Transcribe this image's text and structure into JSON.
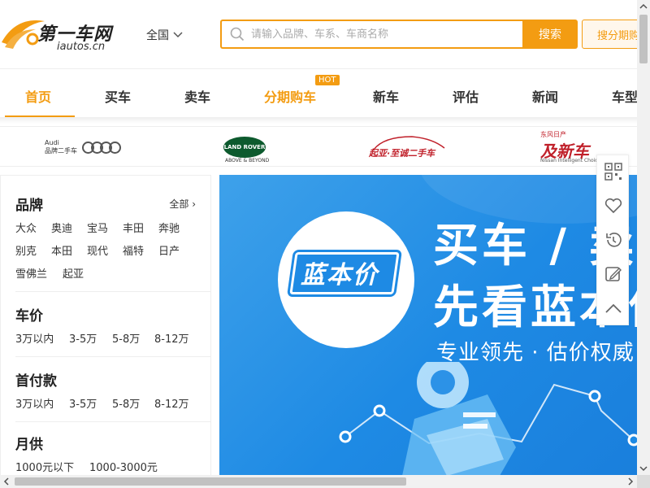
{
  "header": {
    "logo_title": "第一车网",
    "logo_sub": "iautos.cn",
    "city": "全国",
    "search_placeholder": "请输入品牌、车系、车商名称",
    "search_button": "搜索",
    "installment_button": "搜分期购"
  },
  "nav": {
    "items": [
      "首页",
      "买车",
      "卖车",
      "分期购车",
      "新车",
      "评估",
      "新闻",
      "车型"
    ],
    "active_index": 0,
    "hot_badge": "HOT"
  },
  "brand_strip": {
    "audi_line1": "Audi",
    "audi_line2": "品牌二手车",
    "land_rover": "LAND ROVER",
    "land_rover_sub": "ABOVE & BEYOND",
    "kia": "起亚·至诚二手车",
    "nissan_top": "东风日产",
    "nissan": "及新车",
    "nissan_sub": "Nissan Intelligent Choice"
  },
  "filter": {
    "brand": {
      "title": "品牌",
      "all_label": "全部",
      "options": [
        "大众",
        "奥迪",
        "宝马",
        "丰田",
        "奔驰",
        "别克",
        "本田",
        "现代",
        "福特",
        "日产",
        "雪佛兰",
        "起亚"
      ]
    },
    "price": {
      "title": "车价",
      "options": [
        "3万以内",
        "3-5万",
        "5-8万",
        "8-12万"
      ]
    },
    "down_payment": {
      "title": "首付款",
      "options": [
        "3万以内",
        "3-5万",
        "5-8万",
        "8-12万"
      ]
    },
    "monthly": {
      "title": "月供",
      "options": [
        "1000元以下",
        "1000-3000元"
      ]
    }
  },
  "banner": {
    "logo_text": "蓝本价",
    "headline1": "买车 / 卖车",
    "headline2": "先看蓝本价",
    "slogan": "专业领先 · 估价权威"
  },
  "float_bar": {
    "icons": [
      "qrcode-icon",
      "heart-icon",
      "history-icon",
      "edit-icon",
      "chevron-up-icon"
    ]
  },
  "colors": {
    "accent": "#f39c12",
    "banner_blue": "#1e8ae4"
  }
}
